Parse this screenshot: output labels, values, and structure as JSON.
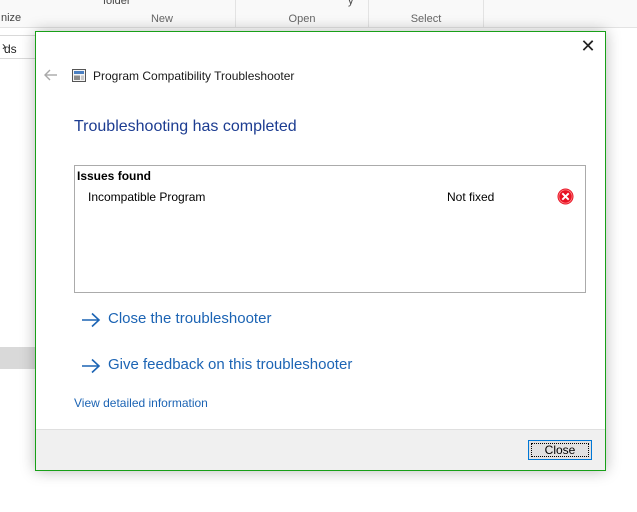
{
  "background": {
    "ribbon_fragments": {
      "new_top": "folder",
      "organize": "nize",
      "open_top": "y"
    },
    "ribbon_groups": [
      "New",
      "Open",
      "Select"
    ],
    "address_fragment": "ds"
  },
  "dialog": {
    "title": "Program Compatibility Troubleshooter",
    "heading": "Troubleshooting has completed",
    "issues": {
      "header": "Issues found",
      "rows": [
        {
          "name": "Incompatible Program",
          "status": "Not fixed",
          "icon": "error-icon"
        }
      ]
    },
    "links": {
      "close_troubleshooter": "Close the troubleshooter",
      "give_feedback": "Give feedback on this troubleshooter",
      "view_details": "View detailed information"
    },
    "footer": {
      "close_label": "Close"
    }
  },
  "colors": {
    "heading": "#1c3c91",
    "link": "#1c64b4",
    "dialog_border": "#18a018",
    "error": "#e81123"
  }
}
